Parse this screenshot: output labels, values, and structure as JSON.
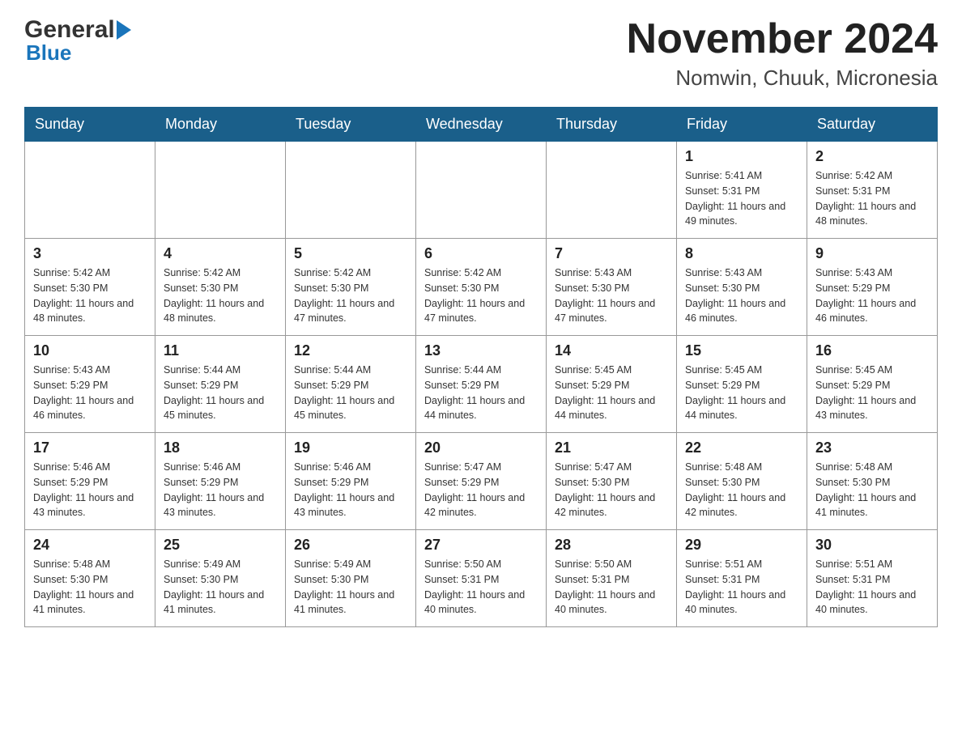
{
  "header": {
    "logo_general": "General",
    "logo_blue": "Blue",
    "month_title": "November 2024",
    "location": "Nomwin, Chuuk, Micronesia"
  },
  "days_of_week": [
    "Sunday",
    "Monday",
    "Tuesday",
    "Wednesday",
    "Thursday",
    "Friday",
    "Saturday"
  ],
  "weeks": [
    [
      {
        "day": "",
        "sunrise": "",
        "sunset": "",
        "daylight": ""
      },
      {
        "day": "",
        "sunrise": "",
        "sunset": "",
        "daylight": ""
      },
      {
        "day": "",
        "sunrise": "",
        "sunset": "",
        "daylight": ""
      },
      {
        "day": "",
        "sunrise": "",
        "sunset": "",
        "daylight": ""
      },
      {
        "day": "",
        "sunrise": "",
        "sunset": "",
        "daylight": ""
      },
      {
        "day": "1",
        "sunrise": "Sunrise: 5:41 AM",
        "sunset": "Sunset: 5:31 PM",
        "daylight": "Daylight: 11 hours and 49 minutes."
      },
      {
        "day": "2",
        "sunrise": "Sunrise: 5:42 AM",
        "sunset": "Sunset: 5:31 PM",
        "daylight": "Daylight: 11 hours and 48 minutes."
      }
    ],
    [
      {
        "day": "3",
        "sunrise": "Sunrise: 5:42 AM",
        "sunset": "Sunset: 5:30 PM",
        "daylight": "Daylight: 11 hours and 48 minutes."
      },
      {
        "day": "4",
        "sunrise": "Sunrise: 5:42 AM",
        "sunset": "Sunset: 5:30 PM",
        "daylight": "Daylight: 11 hours and 48 minutes."
      },
      {
        "day": "5",
        "sunrise": "Sunrise: 5:42 AM",
        "sunset": "Sunset: 5:30 PM",
        "daylight": "Daylight: 11 hours and 47 minutes."
      },
      {
        "day": "6",
        "sunrise": "Sunrise: 5:42 AM",
        "sunset": "Sunset: 5:30 PM",
        "daylight": "Daylight: 11 hours and 47 minutes."
      },
      {
        "day": "7",
        "sunrise": "Sunrise: 5:43 AM",
        "sunset": "Sunset: 5:30 PM",
        "daylight": "Daylight: 11 hours and 47 minutes."
      },
      {
        "day": "8",
        "sunrise": "Sunrise: 5:43 AM",
        "sunset": "Sunset: 5:30 PM",
        "daylight": "Daylight: 11 hours and 46 minutes."
      },
      {
        "day": "9",
        "sunrise": "Sunrise: 5:43 AM",
        "sunset": "Sunset: 5:29 PM",
        "daylight": "Daylight: 11 hours and 46 minutes."
      }
    ],
    [
      {
        "day": "10",
        "sunrise": "Sunrise: 5:43 AM",
        "sunset": "Sunset: 5:29 PM",
        "daylight": "Daylight: 11 hours and 46 minutes."
      },
      {
        "day": "11",
        "sunrise": "Sunrise: 5:44 AM",
        "sunset": "Sunset: 5:29 PM",
        "daylight": "Daylight: 11 hours and 45 minutes."
      },
      {
        "day": "12",
        "sunrise": "Sunrise: 5:44 AM",
        "sunset": "Sunset: 5:29 PM",
        "daylight": "Daylight: 11 hours and 45 minutes."
      },
      {
        "day": "13",
        "sunrise": "Sunrise: 5:44 AM",
        "sunset": "Sunset: 5:29 PM",
        "daylight": "Daylight: 11 hours and 44 minutes."
      },
      {
        "day": "14",
        "sunrise": "Sunrise: 5:45 AM",
        "sunset": "Sunset: 5:29 PM",
        "daylight": "Daylight: 11 hours and 44 minutes."
      },
      {
        "day": "15",
        "sunrise": "Sunrise: 5:45 AM",
        "sunset": "Sunset: 5:29 PM",
        "daylight": "Daylight: 11 hours and 44 minutes."
      },
      {
        "day": "16",
        "sunrise": "Sunrise: 5:45 AM",
        "sunset": "Sunset: 5:29 PM",
        "daylight": "Daylight: 11 hours and 43 minutes."
      }
    ],
    [
      {
        "day": "17",
        "sunrise": "Sunrise: 5:46 AM",
        "sunset": "Sunset: 5:29 PM",
        "daylight": "Daylight: 11 hours and 43 minutes."
      },
      {
        "day": "18",
        "sunrise": "Sunrise: 5:46 AM",
        "sunset": "Sunset: 5:29 PM",
        "daylight": "Daylight: 11 hours and 43 minutes."
      },
      {
        "day": "19",
        "sunrise": "Sunrise: 5:46 AM",
        "sunset": "Sunset: 5:29 PM",
        "daylight": "Daylight: 11 hours and 43 minutes."
      },
      {
        "day": "20",
        "sunrise": "Sunrise: 5:47 AM",
        "sunset": "Sunset: 5:29 PM",
        "daylight": "Daylight: 11 hours and 42 minutes."
      },
      {
        "day": "21",
        "sunrise": "Sunrise: 5:47 AM",
        "sunset": "Sunset: 5:30 PM",
        "daylight": "Daylight: 11 hours and 42 minutes."
      },
      {
        "day": "22",
        "sunrise": "Sunrise: 5:48 AM",
        "sunset": "Sunset: 5:30 PM",
        "daylight": "Daylight: 11 hours and 42 minutes."
      },
      {
        "day": "23",
        "sunrise": "Sunrise: 5:48 AM",
        "sunset": "Sunset: 5:30 PM",
        "daylight": "Daylight: 11 hours and 41 minutes."
      }
    ],
    [
      {
        "day": "24",
        "sunrise": "Sunrise: 5:48 AM",
        "sunset": "Sunset: 5:30 PM",
        "daylight": "Daylight: 11 hours and 41 minutes."
      },
      {
        "day": "25",
        "sunrise": "Sunrise: 5:49 AM",
        "sunset": "Sunset: 5:30 PM",
        "daylight": "Daylight: 11 hours and 41 minutes."
      },
      {
        "day": "26",
        "sunrise": "Sunrise: 5:49 AM",
        "sunset": "Sunset: 5:30 PM",
        "daylight": "Daylight: 11 hours and 41 minutes."
      },
      {
        "day": "27",
        "sunrise": "Sunrise: 5:50 AM",
        "sunset": "Sunset: 5:31 PM",
        "daylight": "Daylight: 11 hours and 40 minutes."
      },
      {
        "day": "28",
        "sunrise": "Sunrise: 5:50 AM",
        "sunset": "Sunset: 5:31 PM",
        "daylight": "Daylight: 11 hours and 40 minutes."
      },
      {
        "day": "29",
        "sunrise": "Sunrise: 5:51 AM",
        "sunset": "Sunset: 5:31 PM",
        "daylight": "Daylight: 11 hours and 40 minutes."
      },
      {
        "day": "30",
        "sunrise": "Sunrise: 5:51 AM",
        "sunset": "Sunset: 5:31 PM",
        "daylight": "Daylight: 11 hours and 40 minutes."
      }
    ]
  ]
}
